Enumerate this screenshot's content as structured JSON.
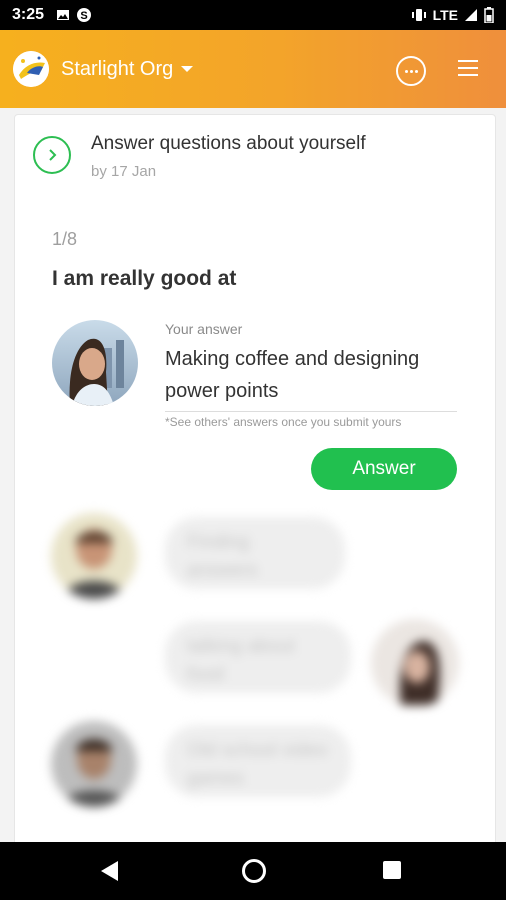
{
  "status_bar": {
    "time": "3:25",
    "network": "LTE"
  },
  "app_bar": {
    "org_name": "Starlight Org",
    "accent": "#f5a623"
  },
  "task": {
    "title": "Answer questions about yourself",
    "due": "by 17 Jan"
  },
  "question": {
    "counter": "1/8",
    "text": "I am really good at"
  },
  "answer": {
    "label": "Your answer",
    "value": "Making coffee and designing power points",
    "hint": "*See others' answers once you submit yours",
    "button_label": "Answer",
    "button_color": "#21c04f"
  },
  "others": [
    {
      "text": "Finding answers",
      "side": "left"
    },
    {
      "text": "talking about food",
      "side": "right"
    },
    {
      "text": "Old school video games",
      "side": "left"
    }
  ]
}
